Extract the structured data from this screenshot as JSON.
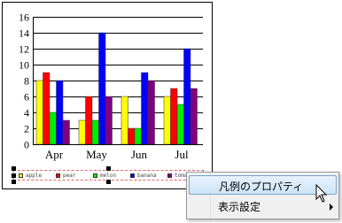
{
  "chart_data": {
    "type": "bar",
    "categories": [
      "Apr",
      "May",
      "Jun",
      "Jul"
    ],
    "series": [
      {
        "name": "apple",
        "color": "#ffff00",
        "values": [
          8,
          3,
          6,
          6
        ]
      },
      {
        "name": "pear",
        "color": "#ff0000",
        "values": [
          9,
          6,
          2,
          7
        ]
      },
      {
        "name": "melon",
        "color": "#00ee00",
        "values": [
          4,
          3,
          2,
          5
        ]
      },
      {
        "name": "banana",
        "color": "#0000ff",
        "values": [
          8,
          14,
          9,
          12
        ]
      },
      {
        "name": "tomato",
        "color": "#800080",
        "values": [
          3,
          6,
          8,
          7
        ]
      }
    ],
    "ylim": [
      0,
      16
    ],
    "yticks": [
      "0",
      "2",
      "4",
      "6",
      "8",
      "10",
      "12",
      "14",
      "16"
    ],
    "grid": true,
    "legend_position": "bottom"
  },
  "context_menu": {
    "items": [
      {
        "label": "凡例のプロパティ",
        "highlighted": true,
        "has_submenu": false
      },
      {
        "label": "表示設定",
        "highlighted": false,
        "has_submenu": true
      }
    ]
  }
}
